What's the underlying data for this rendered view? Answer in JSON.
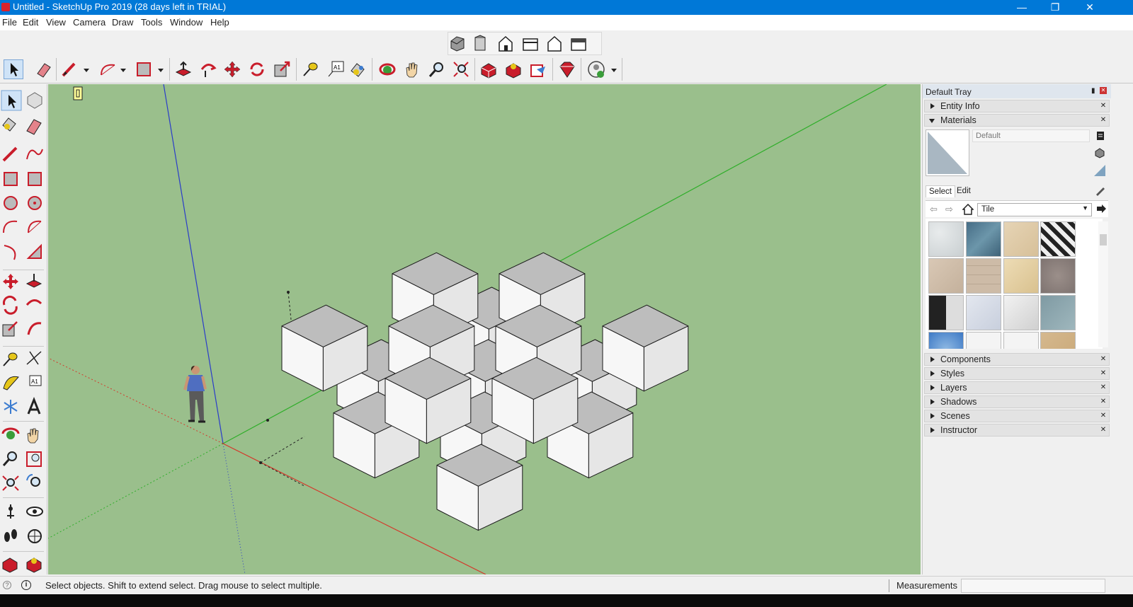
{
  "window": {
    "title": "Untitled - SketchUp Pro 2019 (28 days left in TRIAL)"
  },
  "menu": [
    "File",
    "Edit",
    "View",
    "Camera",
    "Draw",
    "Tools",
    "Window",
    "Help"
  ],
  "tray": {
    "title": "Default Tray",
    "panels_top": [
      "Entity Info",
      "Materials"
    ],
    "materials": {
      "name_value": "Default",
      "tab_select": "Select",
      "tab_edit": "Edit",
      "collection": "Tile"
    },
    "panels_bottom": [
      "Components",
      "Styles",
      "Layers",
      "Shadows",
      "Scenes",
      "Instructor"
    ]
  },
  "status": {
    "message": "Select objects. Shift to extend select. Drag mouse to select multiple.",
    "measurements_label": "Measurements",
    "measurements_value": ""
  },
  "colors": {
    "titlebar": "#0078d7",
    "viewport": "#9abf8c",
    "axis_red": "#d33a2c",
    "axis_green": "#2fae2a",
    "axis_blue": "#2a3cc9"
  },
  "icons": {
    "window_controls": [
      "minimize-icon",
      "restore-icon",
      "close-icon"
    ],
    "tray_materials": [
      "details-icon",
      "create-material-icon",
      "default-material-icon",
      "sample-paint-icon"
    ]
  }
}
